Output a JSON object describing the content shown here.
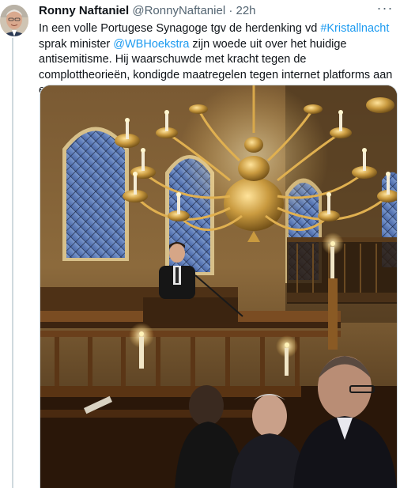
{
  "tweet": {
    "author": {
      "display_name": "Ronny Naftaniel",
      "handle": "@RonnyNaftaniel",
      "avatar_icon": "user-avatar"
    },
    "separator": "·",
    "timestamp": "22h",
    "more_icon": "more-horizontal-icon",
    "text": {
      "part1": "In een volle Portugese Synagoge tgv de herdenking vd ",
      "hashtag": "#Kristallnacht",
      "part2": " sprak minister ",
      "mention": "@WBHoekstra",
      "part3": " zijn woede uit over het huidige antisemitisme. Hij waarschuwde met kracht tegen de complottheorieën, kondigde maatregelen tegen internet platforms aan en riep allen op tot tegenspraak."
    },
    "media": {
      "type": "photo"
    }
  },
  "colors": {
    "link": "#1d9bf0",
    "text": "#0f1419",
    "secondary": "#536471",
    "thread_line": "#cfd9de"
  }
}
